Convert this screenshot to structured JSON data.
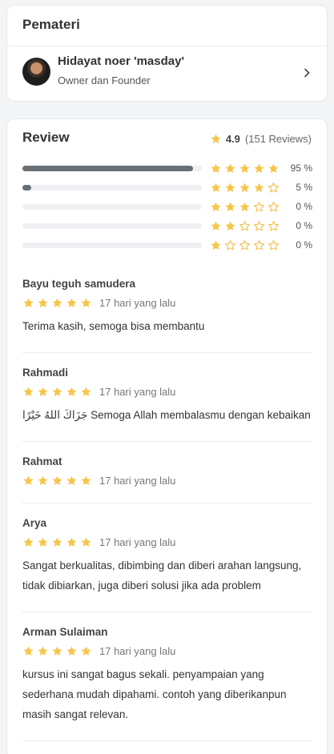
{
  "pemateri": {
    "title": "Pemateri",
    "speaker": {
      "name": "Hidayat noer 'masday'",
      "role": "Owner dan Founder"
    }
  },
  "review": {
    "title": "Review",
    "score": "4.9",
    "count_label": "(151 Reviews)",
    "distribution": [
      {
        "stars": 5,
        "fraction": 0.95,
        "label": "95 %"
      },
      {
        "stars": 4,
        "fraction": 0.05,
        "label": "5 %"
      },
      {
        "stars": 3,
        "fraction": 0.0,
        "label": "0 %"
      },
      {
        "stars": 2,
        "fraction": 0.0,
        "label": "0 %"
      },
      {
        "stars": 1,
        "fraction": 0.0,
        "label": "0 %"
      }
    ],
    "items": [
      {
        "name": "Bayu teguh samudera",
        "rating": 5,
        "time": "17 hari yang lalu",
        "text": "Terima kasih, semoga bisa membantu"
      },
      {
        "name": "Rahmadi",
        "rating": 5,
        "time": "17 hari yang lalu",
        "text": "جَزَاكَ اللهُ خَيْرًا Semoga Allah membalasmu dengan kebaikan"
      },
      {
        "name": "Rahmat",
        "rating": 5,
        "time": "17 hari yang lalu",
        "text": ""
      },
      {
        "name": "Arya",
        "rating": 5,
        "time": "17 hari yang lalu",
        "text": "Sangat berkualitas, dibimbing dan diberi arahan langsung, tidak dibiarkan, juga diberi solusi jika ada problem"
      },
      {
        "name": "Arman Sulaiman",
        "rating": 5,
        "time": "17 hari yang lalu",
        "text": "kursus ini sangat bagus sekali. penyampaian yang sederhana mudah dipahami. contoh yang diberikanpun masih sangat relevan."
      }
    ]
  },
  "colors": {
    "star_filled": "#f7c548",
    "star_empty": "#f2b93b",
    "bar_fill": "#687075",
    "bar_track": "#eef0f4"
  },
  "icons": {
    "star": "star-icon",
    "chevron": "chevron-right-icon"
  }
}
